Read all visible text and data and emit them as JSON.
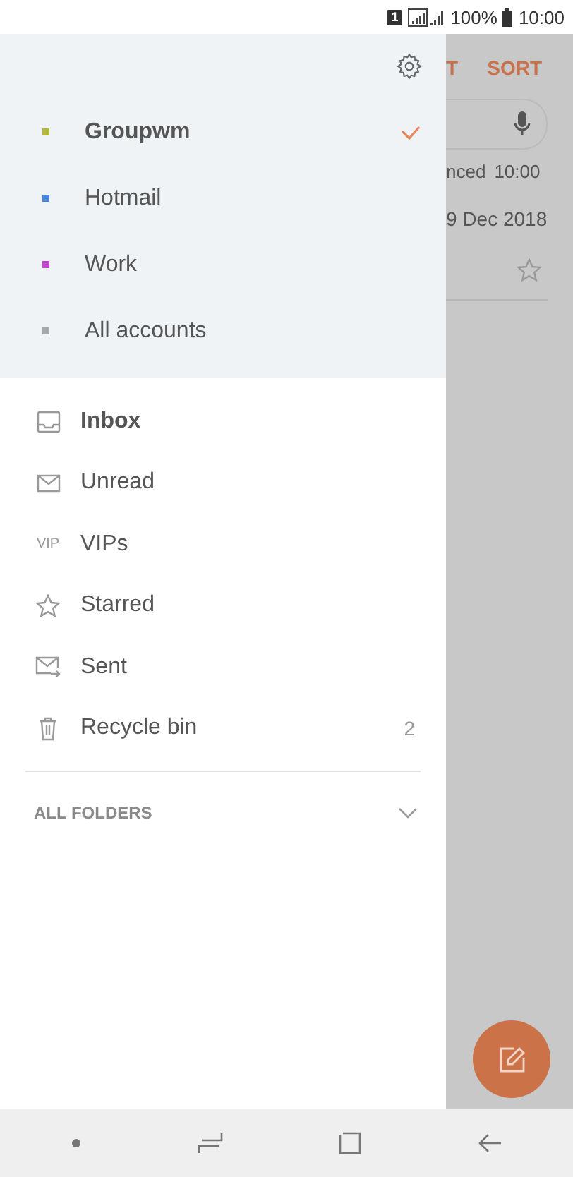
{
  "status_bar": {
    "sim": "1",
    "battery": "100%",
    "time": "10:00"
  },
  "background_screen": {
    "toolbar_actions": [
      "T",
      "SORT"
    ],
    "sync_status": "nced",
    "sync_time": "10:00",
    "date": "9 Dec 2018"
  },
  "accounts": [
    {
      "name": "Groupwm",
      "color": "#b5b83a",
      "selected": true
    },
    {
      "name": "Hotmail",
      "color": "#4a86d8",
      "selected": false
    },
    {
      "name": "Work",
      "color": "#c04ad0",
      "selected": false
    },
    {
      "name": "All accounts",
      "color": "#a8a8a8",
      "selected": false
    }
  ],
  "folders": [
    {
      "kind": "inbox",
      "label": "Inbox",
      "selected": true
    },
    {
      "kind": "unread",
      "label": "Unread",
      "selected": false
    },
    {
      "kind": "vip",
      "icon_text": "VIP",
      "label": "VIPs",
      "selected": false
    },
    {
      "kind": "starred",
      "label": "Starred",
      "selected": false
    },
    {
      "kind": "sent",
      "label": "Sent",
      "selected": false
    },
    {
      "kind": "trash",
      "label": "Recycle bin",
      "count": "2",
      "selected": false
    }
  ],
  "all_folders": {
    "label": "ALL FOLDERS",
    "expanded": false
  }
}
